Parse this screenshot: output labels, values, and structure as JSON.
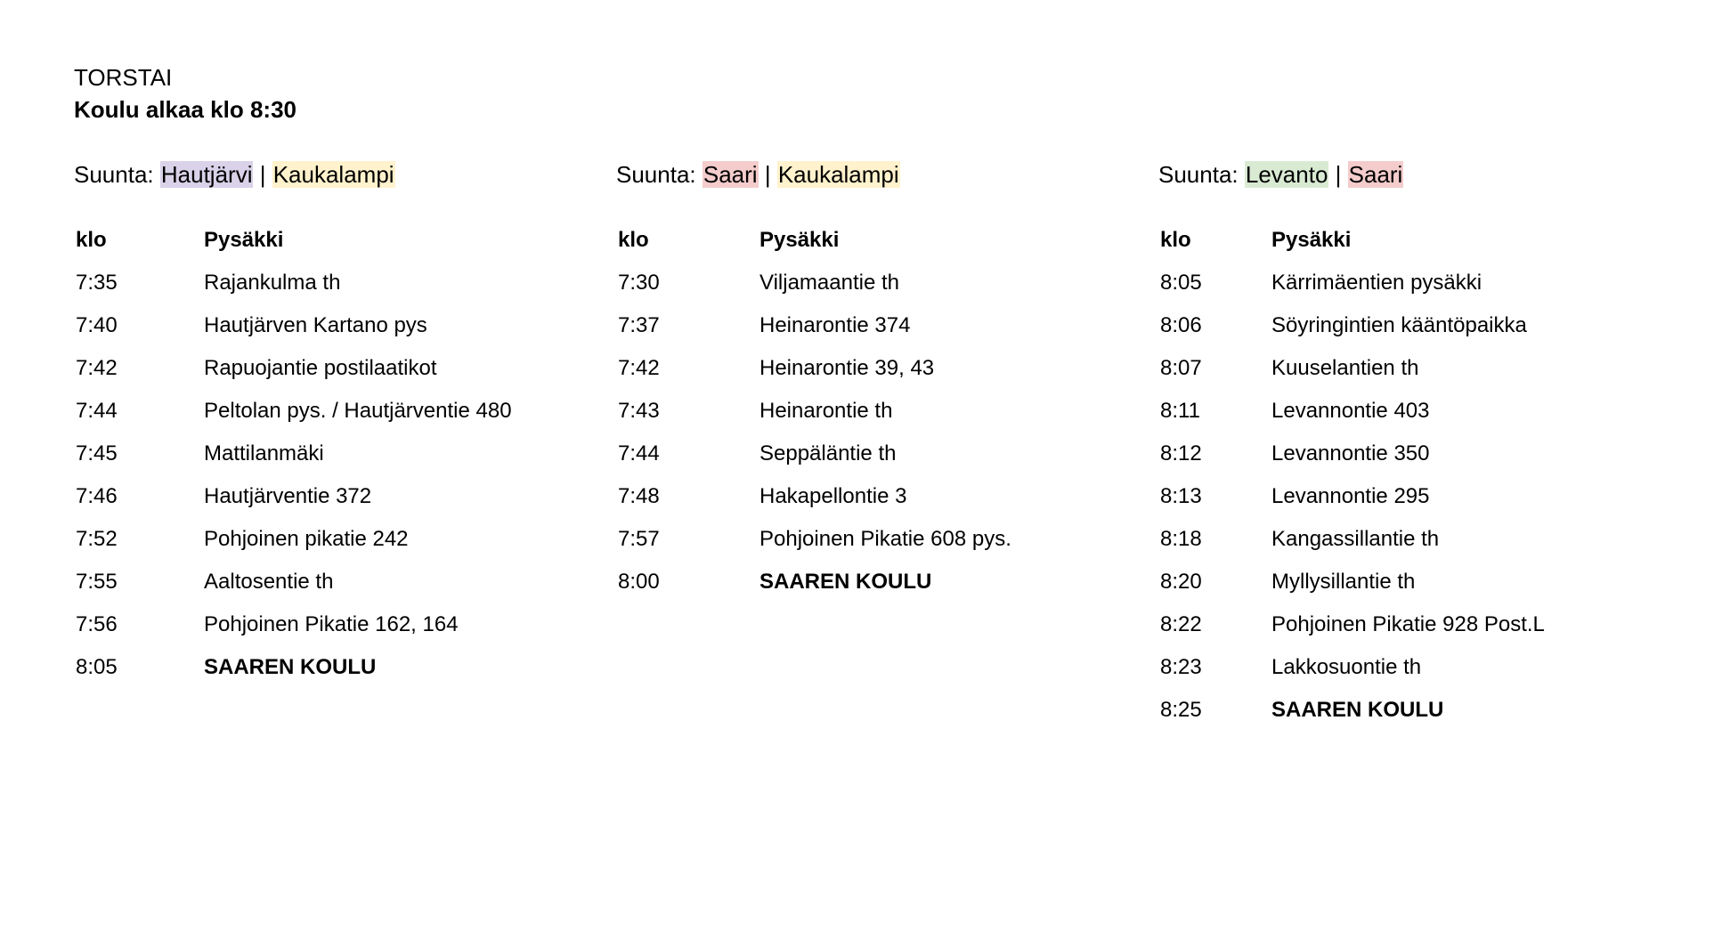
{
  "day": "TORSTAI",
  "start": "Koulu alkaa klo 8:30",
  "colors": {
    "Hautjärvi": "#d9d2e9",
    "Kaukalampi": "#fff2cc",
    "Saari": "#f4cccc",
    "Levanto": "#d9ead3"
  },
  "columns": [
    {
      "prefix": "Suunta:",
      "dest1": "Hautjärvi",
      "sep": "|",
      "dest2": "Kaukalampi",
      "header_time": "klo",
      "header_stop": "Pysäkki",
      "rows": [
        {
          "time": "7:35",
          "stop": "Rajankulma th"
        },
        {
          "time": "7:40",
          "stop": "Hautjärven Kartano pys"
        },
        {
          "time": "7:42",
          "stop": "Rapuojantie postilaatikot"
        },
        {
          "time": "7:44",
          "stop": "Peltolan pys. / Hautjärventie 480"
        },
        {
          "time": "7:45",
          "stop": "Mattilanmäki"
        },
        {
          "time": "7:46",
          "stop": "Hautjärventie 372"
        },
        {
          "time": "7:52",
          "stop": "Pohjoinen pikatie 242"
        },
        {
          "time": "7:55",
          "stop": "Aaltosentie th"
        },
        {
          "time": "7:56",
          "stop": "Pohjoinen Pikatie 162, 164"
        },
        {
          "time": "8:05",
          "stop": "SAAREN KOULU"
        }
      ]
    },
    {
      "prefix": "Suunta:",
      "dest1": "Saari",
      "sep": "|",
      "dest2": "Kaukalampi",
      "header_time": "klo",
      "header_stop": "Pysäkki",
      "rows": [
        {
          "time": "7:30",
          "stop": "Viljamaantie th"
        },
        {
          "time": "7:37",
          "stop": "Heinarontie 374"
        },
        {
          "time": "7:42",
          "stop": "Heinarontie 39, 43"
        },
        {
          "time": "7:43",
          "stop": "Heinarontie th"
        },
        {
          "time": "7:44",
          "stop": "Seppäläntie th"
        },
        {
          "time": "7:48",
          "stop": "Hakapellontie 3"
        },
        {
          "time": "7:57",
          "stop": "Pohjoinen Pikatie 608 pys."
        },
        {
          "time": "8:00",
          "stop": "SAAREN KOULU"
        }
      ]
    },
    {
      "prefix": "Suunta:",
      "dest1": "Levanto",
      "sep": "|",
      "dest2": "Saari",
      "header_time": "klo",
      "header_stop": "Pysäkki",
      "rows": [
        {
          "time": "8:05",
          "stop": "Kärrimäentien pysäkki"
        },
        {
          "time": "8:06",
          "stop": "Söyringintien kääntöpaikka"
        },
        {
          "time": "8:07",
          "stop": "Kuuselantien th"
        },
        {
          "time": "8:11",
          "stop": "Levannontie 403"
        },
        {
          "time": "8:12",
          "stop": "Levannontie 350"
        },
        {
          "time": "8:13",
          "stop": "Levannontie 295"
        },
        {
          "time": "8:18",
          "stop": "Kangassillantie th"
        },
        {
          "time": "8:20",
          "stop": "Myllysillantie th"
        },
        {
          "time": "8:22",
          "stop": "Pohjoinen Pikatie 928 Post.L"
        },
        {
          "time": "8:23",
          "stop": "Lakkosuontie th"
        },
        {
          "time": "8:25",
          "stop": "SAAREN KOULU"
        }
      ]
    }
  ]
}
